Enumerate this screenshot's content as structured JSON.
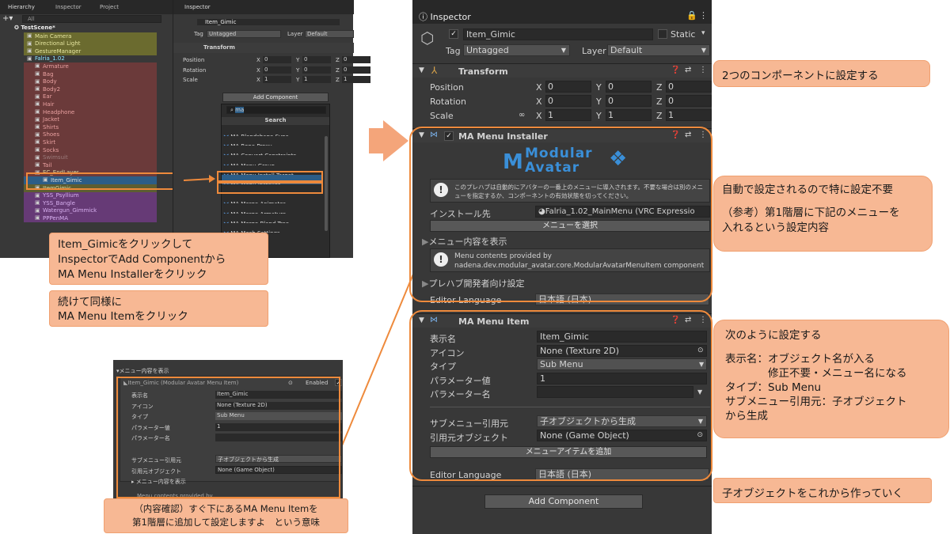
{
  "colors": {
    "accent": "#ee8a3c",
    "callout_bg": "#f7b894",
    "selection": "#2c5d87",
    "panel": "#383838"
  },
  "hierarchy": {
    "tabs": [
      "Hierarchy",
      "Inspector",
      "Project"
    ],
    "search": "All",
    "scene": "TestScene*",
    "items": [
      {
        "label": "Main Camera",
        "color": "#e6e6a0",
        "indent": 1
      },
      {
        "label": "Directional Light",
        "color": "#e6e6a0",
        "indent": 1
      },
      {
        "label": "GestureManager",
        "color": "#e6e6a0",
        "indent": 1
      },
      {
        "label": "Falria_1.02",
        "color": "#8ee6ff",
        "indent": 1
      },
      {
        "label": "Armature",
        "color": "#e9a0a0",
        "indent": 2
      },
      {
        "label": "Bag",
        "color": "#e9a0a0",
        "indent": 2
      },
      {
        "label": "Body",
        "color": "#e9a0a0",
        "indent": 2
      },
      {
        "label": "Body2",
        "color": "#e9a0a0",
        "indent": 2
      },
      {
        "label": "Ear",
        "color": "#e9a0a0",
        "indent": 2
      },
      {
        "label": "Hair",
        "color": "#e9a0a0",
        "indent": 2
      },
      {
        "label": "Headphone",
        "color": "#e9a0a0",
        "indent": 2
      },
      {
        "label": "Jacket",
        "color": "#e9a0a0",
        "indent": 2
      },
      {
        "label": "Shirts",
        "color": "#e9a0a0",
        "indent": 2
      },
      {
        "label": "Shoes",
        "color": "#e9a0a0",
        "indent": 2
      },
      {
        "label": "Skirt",
        "color": "#e9a0a0",
        "indent": 2
      },
      {
        "label": "Socks",
        "color": "#e9a0a0",
        "indent": 2
      },
      {
        "label": "Swimsuit",
        "color": "#9a7a7a",
        "indent": 2
      },
      {
        "label": "Tail",
        "color": "#e9a0a0",
        "indent": 2
      },
      {
        "label": "EC_EndLayer",
        "color": "#d7d79e",
        "indent": 2
      },
      {
        "label": "Item_Gimic",
        "color": "#e0e0e0",
        "indent": 3,
        "selected": true
      },
      {
        "label": "ItemGimic",
        "color": "#d7d79e",
        "indent": 2
      },
      {
        "label": "YSS_Psyllium",
        "color": "#d8b0f0",
        "indent": 2
      },
      {
        "label": "YSS_Bangle",
        "color": "#d8b0f0",
        "indent": 2
      },
      {
        "label": "Watergun_Gimmick",
        "color": "#d8b0f0",
        "indent": 2
      },
      {
        "label": "PPPenMA",
        "color": "#d8b0f0",
        "indent": 2
      }
    ]
  },
  "small_inspector": {
    "tab": "Inspector",
    "object_name": "Item_Gimic",
    "tag_label": "Tag",
    "tag_value": "Untagged",
    "layer_label": "Layer",
    "layer_value": "Default",
    "transform_title": "Transform",
    "position_label": "Position",
    "rotation_label": "Rotation",
    "scale_label": "Scale",
    "pos": [
      "0",
      "0",
      "0"
    ],
    "rot": [
      "0",
      "0",
      "0"
    ],
    "scl": [
      "1",
      "1",
      "1"
    ],
    "add_component": "Add Component",
    "search_text": "ma",
    "search_header": "Search",
    "results": [
      "MA Blendshape Sync",
      "MA Bone Proxy",
      "MA Convert Constraints",
      "MA Menu Group",
      "MA Menu Install Target",
      "MA Menu Installer",
      "MA Menu Item",
      "MA Merge Animator",
      "MA Merge Armature",
      "MA Merge Blend Tree",
      "MA Mesh Settings",
      "MA ...Blocker"
    ]
  },
  "callouts": {
    "c1": [
      "Item_Gimicをクリックして",
      "InspectorでAdd Componentから",
      "MA Menu Installerをクリック"
    ],
    "c2": [
      "続けて同様に",
      "MA Menu Itemをクリック"
    ],
    "c3": [
      "（内容確認）すぐ下にあるMA Menu Itemを",
      "第1階層に追加して設定しますよ　という意味"
    ],
    "r1": "2つのコンポーネントに設定する",
    "r2": [
      "自動で設定されるので特に設定不要",
      "",
      "（参考）第1階層に下記のメニューを",
      "入れるという設定内容"
    ],
    "r3": [
      "次のように設定する",
      "",
      "表示名：オブジェクト名が入る",
      "　　　　修正不要・メニュー名になる",
      "タイプ：Sub Menu",
      "サブメニュー引用元：子オブジェクト",
      "から生成"
    ],
    "r4": "子オブジェクトをこれから作っていく"
  },
  "preview": {
    "header": "メニュー内容を表示",
    "component": "Item_Gimic (Modular Avatar Menu Item)",
    "enabled": "Enabled",
    "rows": [
      {
        "label": "表示名",
        "value": "Item_Gimic"
      },
      {
        "label": "アイコン",
        "value": "None (Texture 2D)"
      },
      {
        "label": "タイプ",
        "value": "Sub Menu"
      },
      {
        "label": "パラメーター値",
        "value": "1"
      },
      {
        "label": "パラメーター名",
        "value": ""
      }
    ],
    "submenu_label": "サブメニュー引用元",
    "submenu_value": "子オブジェクトから生成",
    "src_label": "引用元オブジェクト",
    "src_value": "None (Game Object)",
    "show_label": "メニュー内容を表示",
    "cut": "Menu contents provided by"
  },
  "inspector": {
    "tab": "Inspector",
    "object_name": "Item_Gimic",
    "static": "Static",
    "tag_label": "Tag",
    "tag_value": "Untagged",
    "layer_label": "Layer",
    "layer_value": "Default",
    "transform_title": "Transform",
    "position_label": "Position",
    "rotation_label": "Rotation",
    "scale_label": "Scale",
    "pos": [
      "0",
      "0",
      "0"
    ],
    "rot": [
      "0",
      "0",
      "0"
    ],
    "scl": [
      "1",
      "1",
      "1"
    ],
    "axis": [
      "X",
      "Y",
      "Z"
    ],
    "installer_title": "MA Menu Installer",
    "logo_top": "Modular",
    "logo_bottom": "Avatar",
    "info1_line1": "このプレハブは自動的にアバターの一番上のメニューに導入されます。不要な場合は別のメニ",
    "info1_line2": "ューを指定するか、コンポーネントの有効状態を切ってください。",
    "install_label": "インストール先",
    "install_value": "Falria_1.02_MainMenu (VRC Expressio",
    "select_menu": "メニューを選択",
    "show_menu": "メニュー内容を表示",
    "info2_line1": "Menu contents provided by",
    "info2_line2": "nadena.dev.modular_avatar.core.ModularAvatarMenuItem component",
    "prefab_dev": "プレハブ開発者向け設定",
    "editor_lang_label": "Editor Language",
    "editor_lang_value": "日本語 (日本)",
    "item_title": "MA Menu Item",
    "item_rows": [
      {
        "label": "表示名",
        "value": "Item_Gimic"
      },
      {
        "label": "アイコン",
        "value": "None (Texture 2D)"
      },
      {
        "label": "タイプ",
        "value": "Sub Menu"
      },
      {
        "label": "パラメーター値",
        "value": "1"
      },
      {
        "label": "パラメーター名",
        "value": ""
      }
    ],
    "submenu_label": "サブメニュー引用元",
    "submenu_value": "子オブジェクトから生成",
    "src_label": "引用元オブジェクト",
    "src_value": "None (Game Object)",
    "add_item": "メニューアイテムを追加",
    "add_component": "Add Component"
  }
}
